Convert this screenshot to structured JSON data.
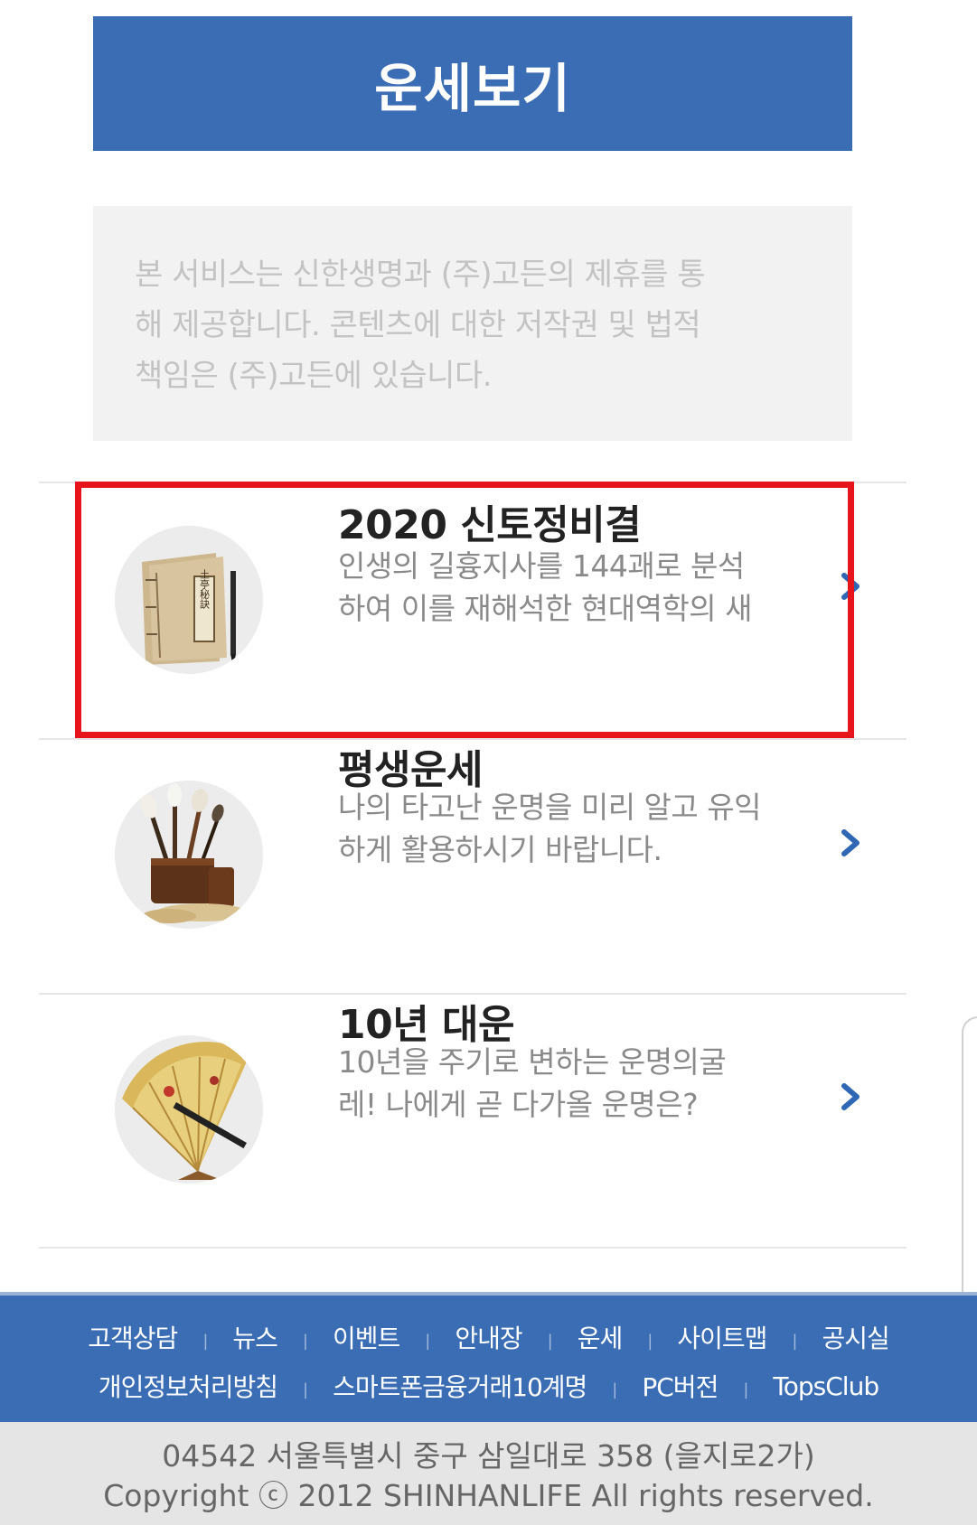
{
  "header": {
    "title": "운세보기"
  },
  "notice": {
    "lines": [
      "본 서비스는 신한생명과 (주)고든의 제휴를 통",
      "해 제공합니다. 콘텐츠에 대한 저작권 및 법적",
      "책임은 (주)고든에 있습니다."
    ]
  },
  "items": [
    {
      "title": "2020 신토정비결",
      "desc_lines": [
        "인생의 길흉지사를 144괘로 분석",
        "하여 이를 재해석한 현대역학의 새"
      ],
      "image": "book-scroll-image",
      "image_text": "土亭秘訣"
    },
    {
      "title": "평생운세",
      "desc_lines": [
        "나의 타고난 운명을 미리 알고 유익",
        "하게 활용하시기 바랍니다."
      ],
      "image": "brushes-image"
    },
    {
      "title": "10년 대운",
      "desc_lines": [
        "10년을 주기로 변하는 운명의굴",
        "레! 나에게 곧 다가올 운명은?"
      ],
      "image": "fan-image"
    }
  ],
  "footer": {
    "row1": [
      "고객상담",
      "뉴스",
      "이벤트",
      "안내장",
      "운세",
      "사이트맵",
      "공시실"
    ],
    "row2": [
      "개인정보처리방침",
      "스마트폰금융거래10계명",
      "PC버전",
      "TopsClub"
    ],
    "address": "04542 서울특별시 중구 삼일대로 358 (을지로2가)",
    "copyright": "Copyright ⓒ 2012 SHINHANLIFE All rights reserved."
  },
  "colors": {
    "brand_blue": "#3a6db3",
    "highlight_red": "#e8141c",
    "chevron_blue": "#2f67b5"
  }
}
